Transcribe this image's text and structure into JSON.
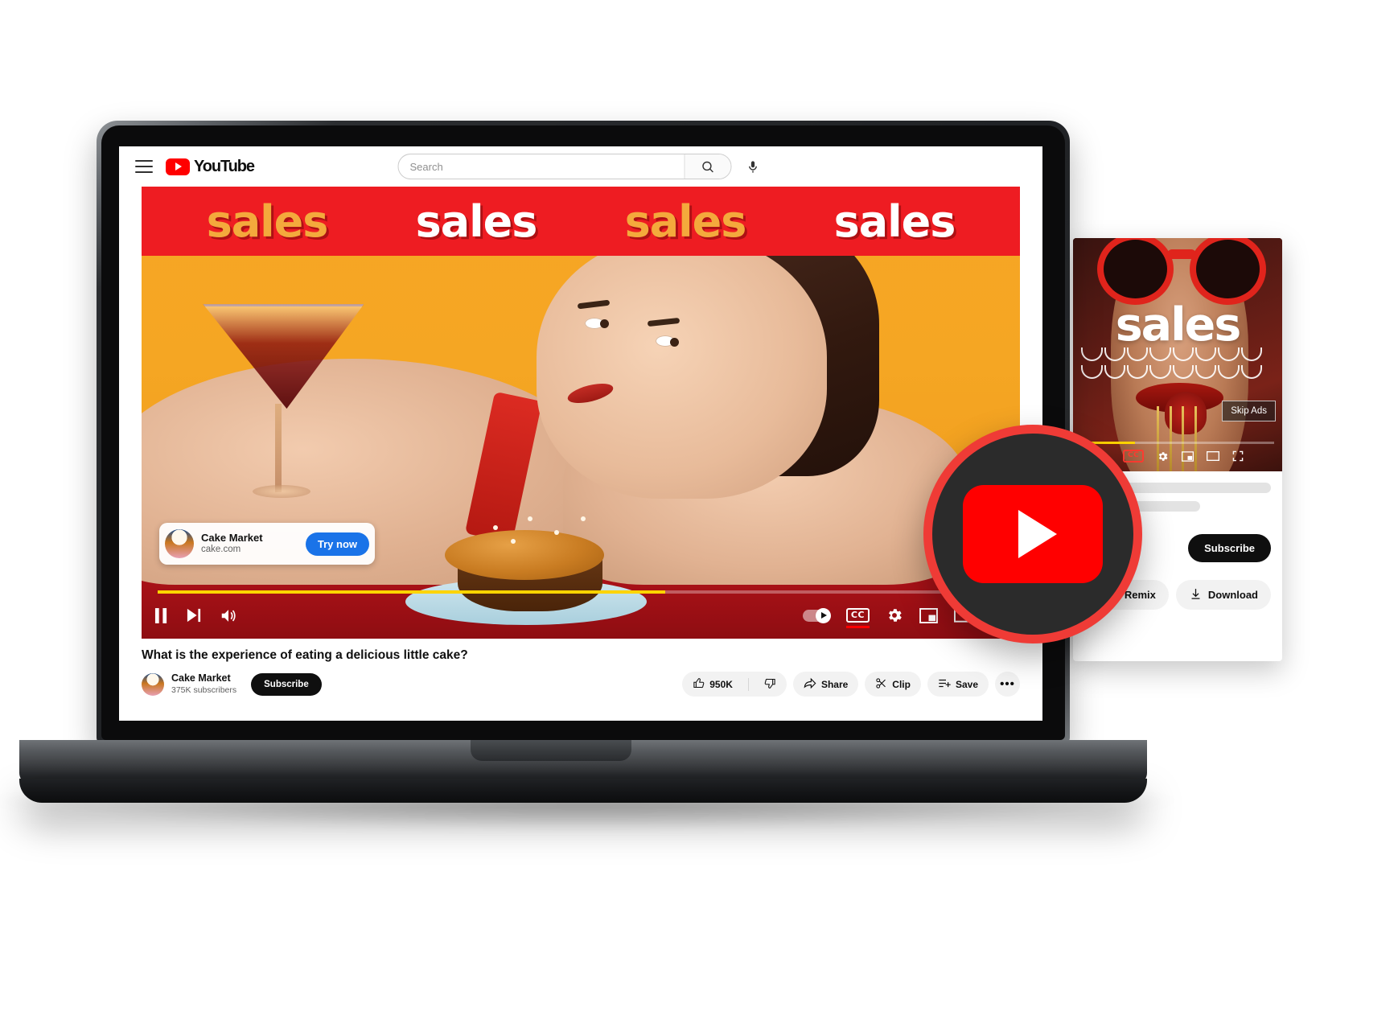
{
  "header": {
    "menu_icon": "hamburger-menu-icon",
    "logo_text": "YouTube",
    "search": {
      "value": "",
      "placeholder": "Search",
      "search_icon": "search-icon",
      "mic_icon": "microphone-icon"
    }
  },
  "banner": {
    "words": [
      {
        "text": "sales",
        "color": "#F4A93C"
      },
      {
        "text": "sales",
        "color": "#FFFFFF"
      },
      {
        "text": "sales",
        "color": "#F4A93C"
      },
      {
        "text": "sales",
        "color": "#FFFFFF"
      }
    ],
    "background": "#EE1C22"
  },
  "ad_overlay": {
    "advertiser": "Cake Market",
    "url": "cake.com",
    "cta": "Try now",
    "cta_color": "#1A73E8"
  },
  "player": {
    "skip_label": "Skip Ads",
    "progress_percent": 60,
    "progress_color": "#FFD400",
    "controls_left": [
      "pause-icon",
      "next-track-icon",
      "volume-icon"
    ],
    "controls_right": [
      "autoplay-toggle",
      "closed-captions-icon",
      "settings-gear-icon",
      "miniplayer-icon",
      "theater-mode-icon",
      "fullscreen-icon"
    ],
    "cc_label": "CC",
    "cc_active": true,
    "autoplay_on": true
  },
  "video": {
    "title": "What is the experience of eating a delicious little cake?",
    "channel_name": "Cake Market",
    "subscriber_count": "375K subscribers",
    "subscribe_label": "Subscribe",
    "actions": {
      "like_count": "950K",
      "like_icon": "thumbs-up-icon",
      "dislike_icon": "thumbs-down-icon",
      "share_label": "Share",
      "share_icon": "share-arrow-icon",
      "clip_label": "Clip",
      "clip_icon": "scissors-icon",
      "save_label": "Save",
      "save_icon": "save-to-playlist-icon",
      "more_label": "•••"
    }
  },
  "phone": {
    "banner_word": "sales",
    "skip_label": "Skip Ads",
    "progress_percent": 28,
    "subscribe_label": "Subscribe",
    "remix_label": "Remix",
    "remix_icon": "remix-icon",
    "download_label": "Download",
    "download_icon": "download-arrow-icon",
    "cc_label": "CC"
  },
  "big_logo": {
    "name": "youtube-play-logo",
    "ring_color": "#EF3B36",
    "body_color": "#2B2B2B",
    "rect_color": "#FF0000"
  }
}
